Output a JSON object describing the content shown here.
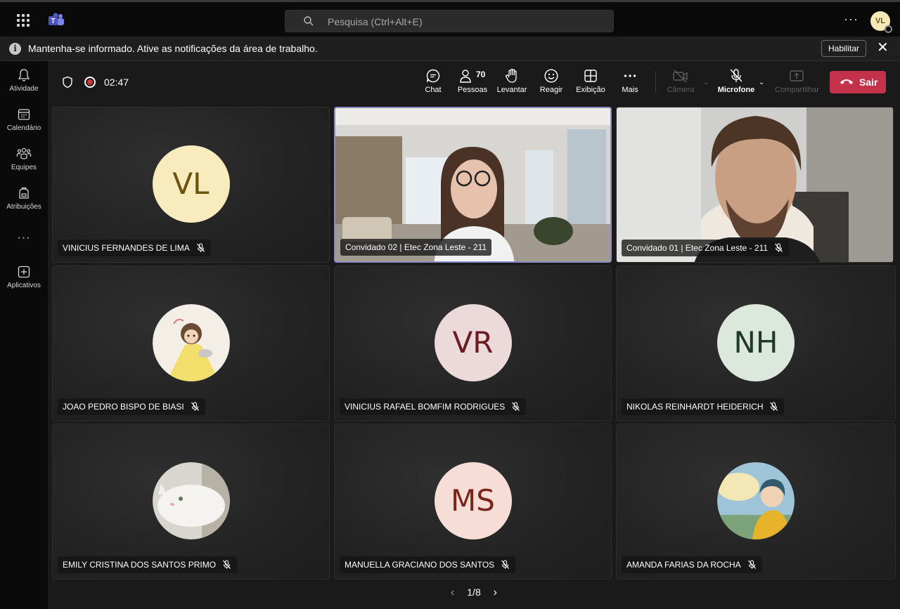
{
  "search": {
    "placeholder": "Pesquisa (Ctrl+Alt+E)"
  },
  "user": {
    "initials": "VL"
  },
  "notice": {
    "message": "Mantenha-se informado. Ative as notificações da área de trabalho.",
    "enable_label": "Habilitar"
  },
  "rail": {
    "items": [
      {
        "label": "Atividade",
        "icon": "bell-icon"
      },
      {
        "label": "Calendário",
        "icon": "calendar-icon"
      },
      {
        "label": "Equipes",
        "icon": "teams-icon"
      },
      {
        "label": "Atribuições",
        "icon": "backpack-icon"
      },
      {
        "label": "Aplicativos",
        "icon": "add-apps-icon"
      }
    ]
  },
  "meeting": {
    "timer": "02:47",
    "controls": {
      "chat": "Chat",
      "people": "Pessoas",
      "people_count": "70",
      "raise": "Levantar",
      "react": "Reagir",
      "view": "Exibição",
      "more": "Mais",
      "camera": "Câmera",
      "mic": "Microfone",
      "share": "Compartilhar",
      "leave": "Sair"
    }
  },
  "participants": [
    {
      "name": "VINICIUS FERNANDES DE LIMA",
      "initials": "VL",
      "avatar_bg": "#f8ebbd",
      "avatar_fg": "#6b5310",
      "type": "initials"
    },
    {
      "name": "Convidado 02 | Etec Zona Leste - 211",
      "initials": "",
      "type": "video-room"
    },
    {
      "name": "Convidado 01 | Etec Zona Leste - 211",
      "initials": "",
      "type": "video-man"
    },
    {
      "name": "JOAO PEDRO BISPO DE BIASI",
      "initials": "",
      "type": "picture-cartoon"
    },
    {
      "name": "VINICIUS RAFAEL BOMFIM RODRIGUES",
      "initials": "VR",
      "avatar_bg": "#ecd9da",
      "avatar_fg": "#6b1a20",
      "type": "initials"
    },
    {
      "name": "NIKOLAS REINHARDT HEIDERICH",
      "initials": "NH",
      "avatar_bg": "#dde8dd",
      "avatar_fg": "#1f3b26",
      "type": "initials"
    },
    {
      "name": "EMILY CRISTINA DOS SANTOS PRIMO",
      "initials": "",
      "type": "picture-cat"
    },
    {
      "name": "MANUELLA GRACIANO DOS SANTOS",
      "initials": "MS",
      "avatar_bg": "#f6ddd6",
      "avatar_fg": "#7a2518",
      "type": "initials"
    },
    {
      "name": "AMANDA FARIAS DA ROCHA",
      "initials": "",
      "type": "picture-anime"
    }
  ],
  "pager": {
    "label": "1/8"
  },
  "colors": {
    "leave": "#c4314b",
    "accent": "#8b8cc7"
  }
}
